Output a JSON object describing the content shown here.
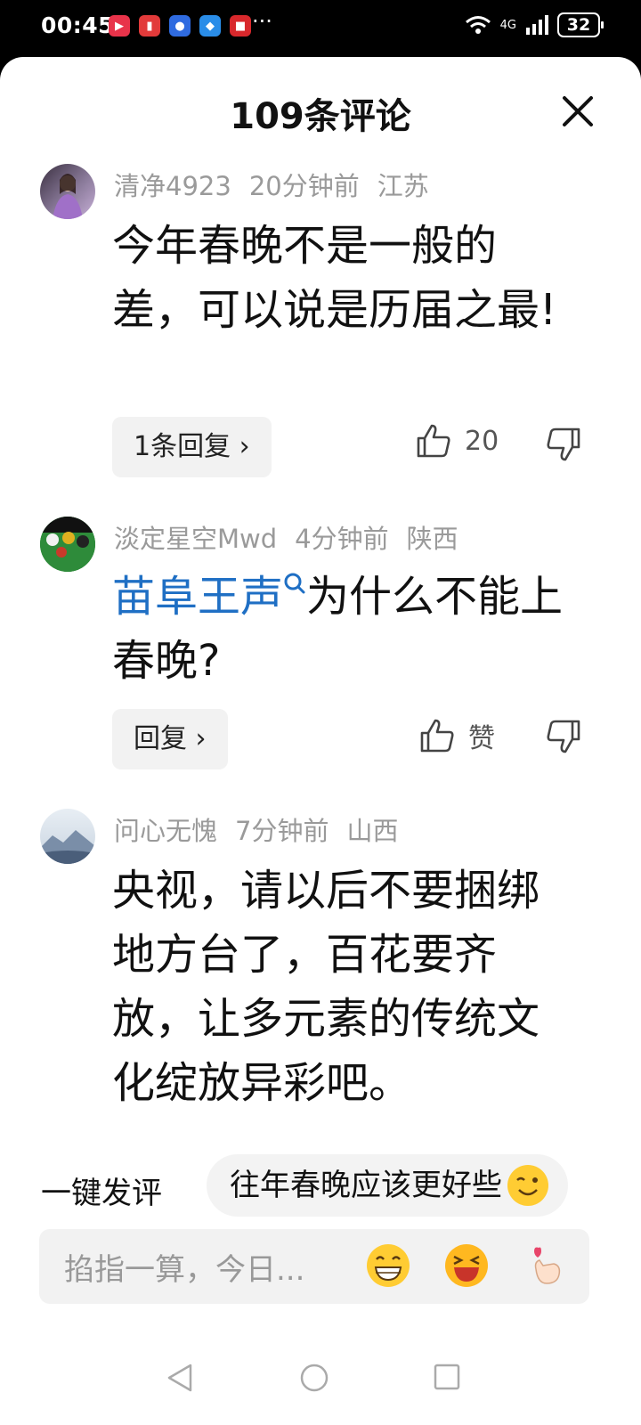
{
  "status_bar": {
    "time": "00:45",
    "network": "4G",
    "battery": "32",
    "more": "···"
  },
  "header": {
    "title": "109条评论"
  },
  "comments": [
    {
      "user": "清净4923",
      "time": "20分钟前",
      "location": "江苏",
      "text": "今年春晚不是一般的差，可以说是历届之最!",
      "reply_label": "1条回复 ›",
      "likes": "20"
    },
    {
      "user": "淡定星空Mwd",
      "time": "4分钟前",
      "location": "陕西",
      "text_link": "苗阜王声",
      "text_rest": "为什么不能上春晚?",
      "reply_label": "回复 ›",
      "likes": "赞"
    },
    {
      "user": "问心无愧",
      "time": "7分钟前",
      "location": "山西",
      "text": "央视，请以后不要捆绑地方台了，百花要齐放，让多元素的传统文化绽放异彩吧。"
    }
  ],
  "quick_reply": {
    "label": "一键发评",
    "suggestion": "往年春晚应该更好些"
  },
  "input": {
    "placeholder": "掐指一算，今日..."
  }
}
